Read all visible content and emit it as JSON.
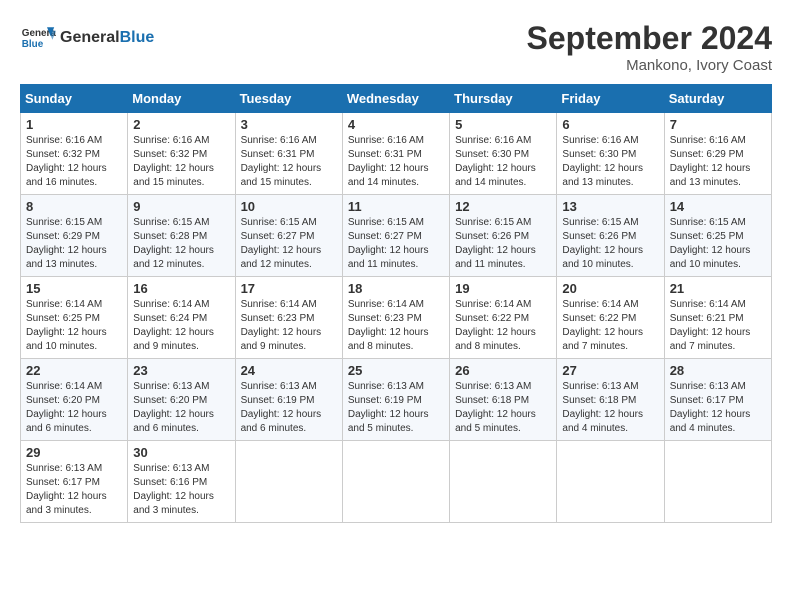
{
  "header": {
    "logo_general": "General",
    "logo_blue": "Blue",
    "month": "September 2024",
    "location": "Mankono, Ivory Coast"
  },
  "weekdays": [
    "Sunday",
    "Monday",
    "Tuesday",
    "Wednesday",
    "Thursday",
    "Friday",
    "Saturday"
  ],
  "weeks": [
    [
      {
        "day": "1",
        "sunrise": "6:16 AM",
        "sunset": "6:32 PM",
        "daylight": "12 hours and 16 minutes."
      },
      {
        "day": "2",
        "sunrise": "6:16 AM",
        "sunset": "6:32 PM",
        "daylight": "12 hours and 15 minutes."
      },
      {
        "day": "3",
        "sunrise": "6:16 AM",
        "sunset": "6:31 PM",
        "daylight": "12 hours and 15 minutes."
      },
      {
        "day": "4",
        "sunrise": "6:16 AM",
        "sunset": "6:31 PM",
        "daylight": "12 hours and 14 minutes."
      },
      {
        "day": "5",
        "sunrise": "6:16 AM",
        "sunset": "6:30 PM",
        "daylight": "12 hours and 14 minutes."
      },
      {
        "day": "6",
        "sunrise": "6:16 AM",
        "sunset": "6:30 PM",
        "daylight": "12 hours and 13 minutes."
      },
      {
        "day": "7",
        "sunrise": "6:16 AM",
        "sunset": "6:29 PM",
        "daylight": "12 hours and 13 minutes."
      }
    ],
    [
      {
        "day": "8",
        "sunrise": "6:15 AM",
        "sunset": "6:29 PM",
        "daylight": "12 hours and 13 minutes."
      },
      {
        "day": "9",
        "sunrise": "6:15 AM",
        "sunset": "6:28 PM",
        "daylight": "12 hours and 12 minutes."
      },
      {
        "day": "10",
        "sunrise": "6:15 AM",
        "sunset": "6:27 PM",
        "daylight": "12 hours and 12 minutes."
      },
      {
        "day": "11",
        "sunrise": "6:15 AM",
        "sunset": "6:27 PM",
        "daylight": "12 hours and 11 minutes."
      },
      {
        "day": "12",
        "sunrise": "6:15 AM",
        "sunset": "6:26 PM",
        "daylight": "12 hours and 11 minutes."
      },
      {
        "day": "13",
        "sunrise": "6:15 AM",
        "sunset": "6:26 PM",
        "daylight": "12 hours and 10 minutes."
      },
      {
        "day": "14",
        "sunrise": "6:15 AM",
        "sunset": "6:25 PM",
        "daylight": "12 hours and 10 minutes."
      }
    ],
    [
      {
        "day": "15",
        "sunrise": "6:14 AM",
        "sunset": "6:25 PM",
        "daylight": "12 hours and 10 minutes."
      },
      {
        "day": "16",
        "sunrise": "6:14 AM",
        "sunset": "6:24 PM",
        "daylight": "12 hours and 9 minutes."
      },
      {
        "day": "17",
        "sunrise": "6:14 AM",
        "sunset": "6:23 PM",
        "daylight": "12 hours and 9 minutes."
      },
      {
        "day": "18",
        "sunrise": "6:14 AM",
        "sunset": "6:23 PM",
        "daylight": "12 hours and 8 minutes."
      },
      {
        "day": "19",
        "sunrise": "6:14 AM",
        "sunset": "6:22 PM",
        "daylight": "12 hours and 8 minutes."
      },
      {
        "day": "20",
        "sunrise": "6:14 AM",
        "sunset": "6:22 PM",
        "daylight": "12 hours and 7 minutes."
      },
      {
        "day": "21",
        "sunrise": "6:14 AM",
        "sunset": "6:21 PM",
        "daylight": "12 hours and 7 minutes."
      }
    ],
    [
      {
        "day": "22",
        "sunrise": "6:14 AM",
        "sunset": "6:20 PM",
        "daylight": "12 hours and 6 minutes."
      },
      {
        "day": "23",
        "sunrise": "6:13 AM",
        "sunset": "6:20 PM",
        "daylight": "12 hours and 6 minutes."
      },
      {
        "day": "24",
        "sunrise": "6:13 AM",
        "sunset": "6:19 PM",
        "daylight": "12 hours and 6 minutes."
      },
      {
        "day": "25",
        "sunrise": "6:13 AM",
        "sunset": "6:19 PM",
        "daylight": "12 hours and 5 minutes."
      },
      {
        "day": "26",
        "sunrise": "6:13 AM",
        "sunset": "6:18 PM",
        "daylight": "12 hours and 5 minutes."
      },
      {
        "day": "27",
        "sunrise": "6:13 AM",
        "sunset": "6:18 PM",
        "daylight": "12 hours and 4 minutes."
      },
      {
        "day": "28",
        "sunrise": "6:13 AM",
        "sunset": "6:17 PM",
        "daylight": "12 hours and 4 minutes."
      }
    ],
    [
      {
        "day": "29",
        "sunrise": "6:13 AM",
        "sunset": "6:17 PM",
        "daylight": "12 hours and 3 minutes."
      },
      {
        "day": "30",
        "sunrise": "6:13 AM",
        "sunset": "6:16 PM",
        "daylight": "12 hours and 3 minutes."
      },
      null,
      null,
      null,
      null,
      null
    ]
  ]
}
